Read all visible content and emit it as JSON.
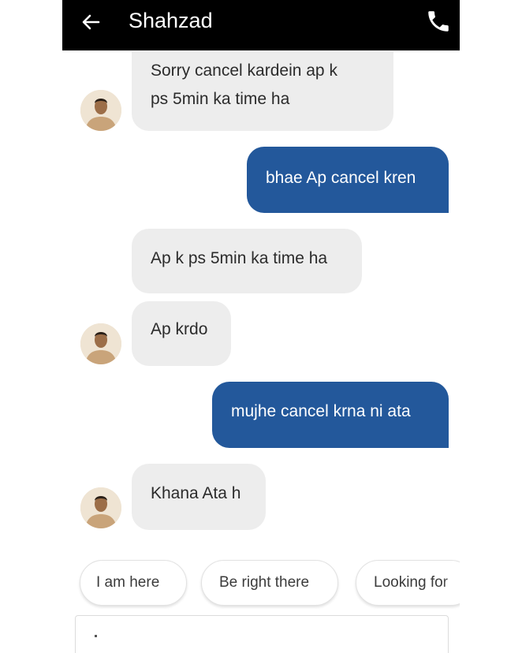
{
  "header": {
    "contact_name": "Shahzad",
    "back_icon": "arrow-left-icon",
    "call_icon": "phone-icon",
    "background": "#000000"
  },
  "messages": [
    {
      "direction": "incoming",
      "lines": [
        "Sorry cancel kardein ap k",
        "ps 5min ka time ha"
      ]
    },
    {
      "direction": "outgoing",
      "lines": [
        "bhae Ap cancel kren"
      ]
    },
    {
      "direction": "incoming",
      "lines": [
        "Ap k ps 5min ka time ha"
      ]
    },
    {
      "direction": "incoming",
      "lines": [
        "Ap krdo"
      ]
    },
    {
      "direction": "outgoing",
      "lines": [
        "mujhe cancel krna ni ata"
      ]
    },
    {
      "direction": "incoming",
      "lines": [
        "Khana Ata h"
      ]
    }
  ],
  "quick_replies": [
    "I am here",
    "Be right there",
    "Looking for"
  ],
  "colors": {
    "outgoing_bubble": "#23589b",
    "incoming_bubble": "#ededed"
  }
}
